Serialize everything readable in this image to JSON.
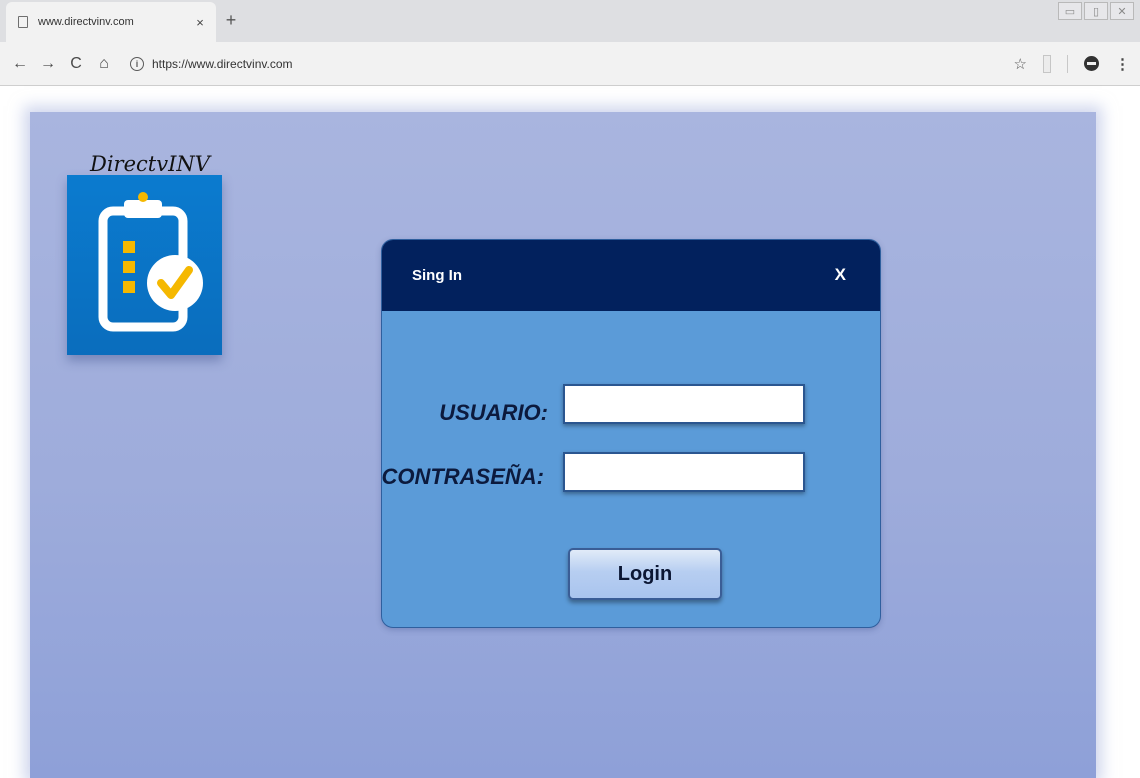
{
  "browser": {
    "tab_title": "www.directvinv.com",
    "tab_close": "×",
    "new_tab": "+",
    "url": "https://www.directvinv.com",
    "back": "←",
    "forward": "→",
    "reload": "C",
    "home": "⌂",
    "star": "☆",
    "menu": "⋮",
    "window_controls": [
      "▭",
      "▯",
      "✕"
    ]
  },
  "logo": {
    "title": "DirectvINV",
    "icon": "clipboard-check-icon",
    "colors": {
      "box": "#0a6dbd",
      "check": "#f5b800"
    }
  },
  "dialog": {
    "title": "Sing In",
    "close_label": "X",
    "user_label": "USUARIO:",
    "password_label": "CONTRASEÑA:",
    "user_value": "",
    "password_value": "",
    "login_label": "Login",
    "colors": {
      "header": "#02215d",
      "body": "#5b9bd8"
    }
  }
}
